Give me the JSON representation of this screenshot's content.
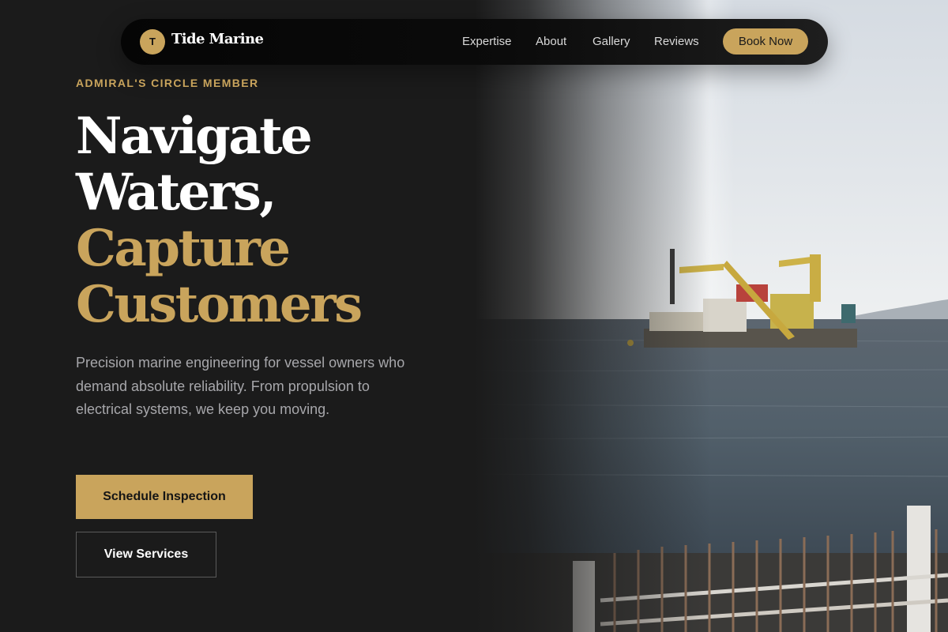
{
  "nav": {
    "logo_letter": "T",
    "brand": "Tide Marine",
    "links": [
      "Expertise",
      "About",
      "Gallery",
      "Reviews"
    ],
    "cta": "Book Now"
  },
  "hero": {
    "eyebrow": "ADMIRAL'S CIRCLE MEMBER",
    "headline_white": [
      "Navigate",
      "Waters,"
    ],
    "headline_gold": [
      "Capture",
      "Customers"
    ],
    "description": "Precision marine engineering for vessel owners who demand absolute reliability. From propulsion to electrical systems, we keep you moving.",
    "primary_button": "Schedule Inspection",
    "secondary_button": "View Services"
  },
  "colors": {
    "background": "#1b1b1b",
    "accent_gold": "#c9a45c",
    "text_white": "#ffffff",
    "text_muted": "#a7a7ab"
  },
  "image": {
    "subject": "dredging vessel on open water with fence in foreground"
  }
}
